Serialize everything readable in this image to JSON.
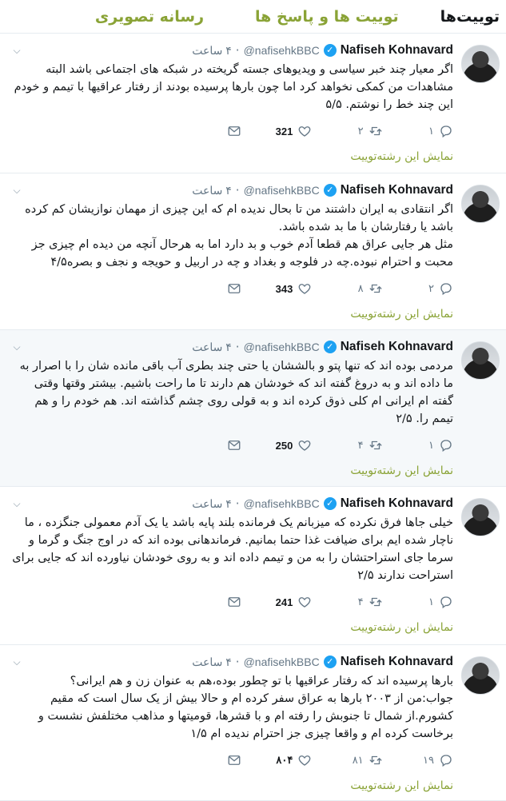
{
  "tabs": [
    {
      "label": "توییت‌ها",
      "active": true
    },
    {
      "label": "توییت ها و پاسخ ها",
      "active": false
    },
    {
      "label": "رسانه تصویری",
      "active": false
    }
  ],
  "colors": {
    "accent": "#8aa336",
    "verified": "#1da1f2",
    "highlight_bg": "#f5f8fa"
  },
  "tweets": [
    {
      "name": "Nafiseh Kohnavard",
      "handle": "@nafisehkBBC",
      "time": "۴ ساعت",
      "text": "اگر معیار چند خبر سیاسی و ویدیوهای جسته گریخته در شبکه های اجتماعی باشد البته مشاهدات من کمکی نخواهد کرد اما چون بارها پرسیده بودند از رفتار عراقیها با تیمم و خودم این چند خط را نوشتم. ۵/۵",
      "replies": "۱",
      "retweets": "۲",
      "likes": "321",
      "thread_label": "نمایش این رشته‌توییت",
      "highlighted": false
    },
    {
      "name": "Nafiseh Kohnavard",
      "handle": "@nafisehkBBC",
      "time": "۴ ساعت",
      "text": "اگر انتقادی به ایران داشتند من تا بحال ندیده ام که این چیزی از مهمان نوازیشان کم کرده باشد یا رفتارشان با ما بد شده باشد.\nمثل هر جایی عراق هم قطعا آدم خوب و بد دارد اما به هرحال آنچه من دیده ام چیزی جز محبت و احترام نبوده.چه در فلوجه و بغداد و چه در اربیل و حویجه و نجف و بصره۴/۵",
      "replies": "۲",
      "retweets": "۸",
      "likes": "343",
      "thread_label": "نمایش این رشته‌توییت",
      "highlighted": false
    },
    {
      "name": "Nafiseh Kohnavard",
      "handle": "@nafisehkBBC",
      "time": "۴ ساعت",
      "text": "مردمی بوده اند که تنها پتو و بالششان یا حتی چند بطری آب باقی مانده شان را با اصرار به ما داده اند و به دروغ گفته اند که خودشان هم دارند تا ما راحت باشیم. بیشتر وقتها وقتی گفته ام ایرانی ام کلی ذوق کرده اند و به قولی روی چشم گذاشته اند. هم خودم را و هم تیمم را. ۲/۵",
      "replies": "۱",
      "retweets": "۴",
      "likes": "250",
      "thread_label": "نمایش این رشته‌توییت",
      "highlighted": true
    },
    {
      "name": "Nafiseh Kohnavard",
      "handle": "@nafisehkBBC",
      "time": "۴ ساعت",
      "text": "خیلی جاها فرق نکرده که میزبانم یک فرمانده بلند پایه باشد یا یک آدم معمولی جنگزده ، ما ناچار شده ایم برای ضیافت غذا حتما بمانیم. فرماندهانی بوده اند که در اوج جنگ و گرما و سرما جای استراحتشان را به من و تیمم داده اند و به روی خودشان نیاورده اند که جایی برای استراحت ندارند ۲/۵",
      "replies": "۱",
      "retweets": "۴",
      "likes": "241",
      "thread_label": "نمایش این رشته‌توییت",
      "highlighted": false
    },
    {
      "name": "Nafiseh Kohnavard",
      "handle": "@nafisehkBBC",
      "time": "۴ ساعت",
      "text": "بارها پرسیده اند که رفتار عراقیها با تو چطور بوده،هم به عنوان زن و هم ایرانی؟\nجواب:من از ۲۰۰۳ بارها به عراق سفر کرده ام و حالا بیش از یک سال است که مقیم کشورم.از شمال تا جنوبش را رفته ام و با قشرها، قومیتها و مذاهب مختلفش نشست و برخاست کرده ام و واقعا چیزی جز احترام ندیده ام ۱/۵",
      "replies": "۱۹",
      "retweets": "۸۱",
      "likes": "۸۰۴",
      "thread_label": "نمایش این رشته‌توییت",
      "highlighted": false
    }
  ]
}
